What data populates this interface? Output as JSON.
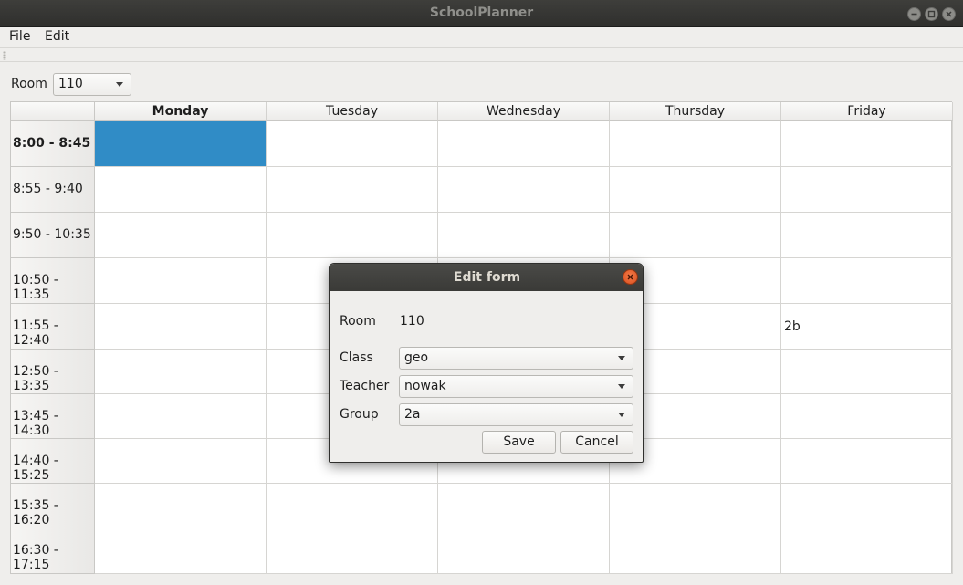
{
  "window": {
    "title": "SchoolPlanner"
  },
  "menu": {
    "file": "File",
    "edit": "Edit"
  },
  "room_selector": {
    "label": "Room",
    "value": "110"
  },
  "grid": {
    "days": [
      "Monday",
      "Tuesday",
      "Wednesday",
      "Thursday",
      "Friday"
    ],
    "times": [
      "8:00 - 8:45",
      "8:55 - 9:40",
      "9:50 - 10:35",
      "10:50 - 11:35",
      "11:55 - 12:40",
      "12:50 - 13:35",
      "13:45 - 14:30",
      "14:40 - 15:25",
      "15:35 - 16:20",
      "16:30 - 17:15"
    ],
    "entries": [
      {
        "time": 4,
        "day": 4,
        "text": "2b"
      }
    ],
    "selected": {
      "time": 0,
      "day": 0
    },
    "selection_color": "#308cc6"
  },
  "dialog": {
    "title": "Edit form",
    "room_label": "Room",
    "room_value": "110",
    "class_label": "Class",
    "class_value": "geo",
    "teacher_label": "Teacher",
    "teacher_value": "nowak",
    "group_label": "Group",
    "group_value": "2a",
    "save_label": "Save",
    "cancel_label": "Cancel"
  }
}
